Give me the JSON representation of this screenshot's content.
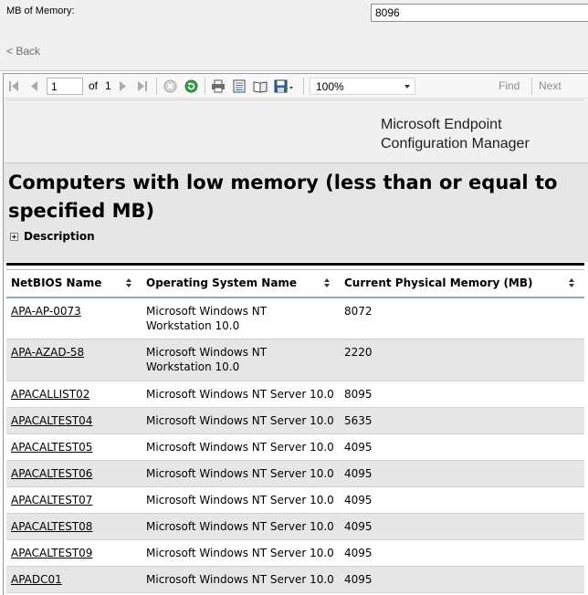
{
  "params": {
    "memory_label": "MB of Memory:",
    "memory_value": "8096",
    "back_label": "< Back"
  },
  "toolbar": {
    "page_current": "1",
    "of_label": "of",
    "page_total": "1",
    "zoom": "100%",
    "find_label": "Find",
    "next_label": "Next",
    "icons": [
      "first-page-icon",
      "prev-page-icon",
      "next-page-icon",
      "last-page-icon",
      "stop-icon",
      "refresh-icon",
      "print-icon",
      "print-layout-icon",
      "page-setup-icon",
      "export-icon"
    ]
  },
  "report": {
    "brand_line1": "Microsoft Endpoint",
    "brand_line2": "Configuration Manager",
    "title": "Computers with low memory (less than or equal to specified MB)",
    "description_label": "Description"
  },
  "table": {
    "columns": [
      "NetBIOS Name",
      "Operating System Name",
      "Current Physical Memory (MB)"
    ],
    "rows": [
      {
        "name": "APA-AP-0073",
        "os": "Microsoft Windows NT Workstation 10.0",
        "memory": "8072"
      },
      {
        "name": "APA-AZAD-58",
        "os": "Microsoft Windows NT Workstation 10.0",
        "memory": "2220"
      },
      {
        "name": "APACALLIST02",
        "os": "Microsoft Windows NT Server 10.0",
        "memory": "8095"
      },
      {
        "name": "APACALTEST04",
        "os": "Microsoft Windows NT Server 10.0",
        "memory": "5635"
      },
      {
        "name": "APACALTEST05",
        "os": "Microsoft Windows NT Server 10.0",
        "memory": "4095"
      },
      {
        "name": "APACALTEST06",
        "os": "Microsoft Windows NT Server 10.0",
        "memory": "4095"
      },
      {
        "name": "APACALTEST07",
        "os": "Microsoft Windows NT Server 10.0",
        "memory": "4095"
      },
      {
        "name": "APACALTEST08",
        "os": "Microsoft Windows NT Server 10.0",
        "memory": "4095"
      },
      {
        "name": "APACALTEST09",
        "os": "Microsoft Windows NT Server 10.0",
        "memory": "4095"
      },
      {
        "name": "APADC01",
        "os": "Microsoft Windows NT Server 10.0",
        "memory": "4095"
      }
    ]
  }
}
